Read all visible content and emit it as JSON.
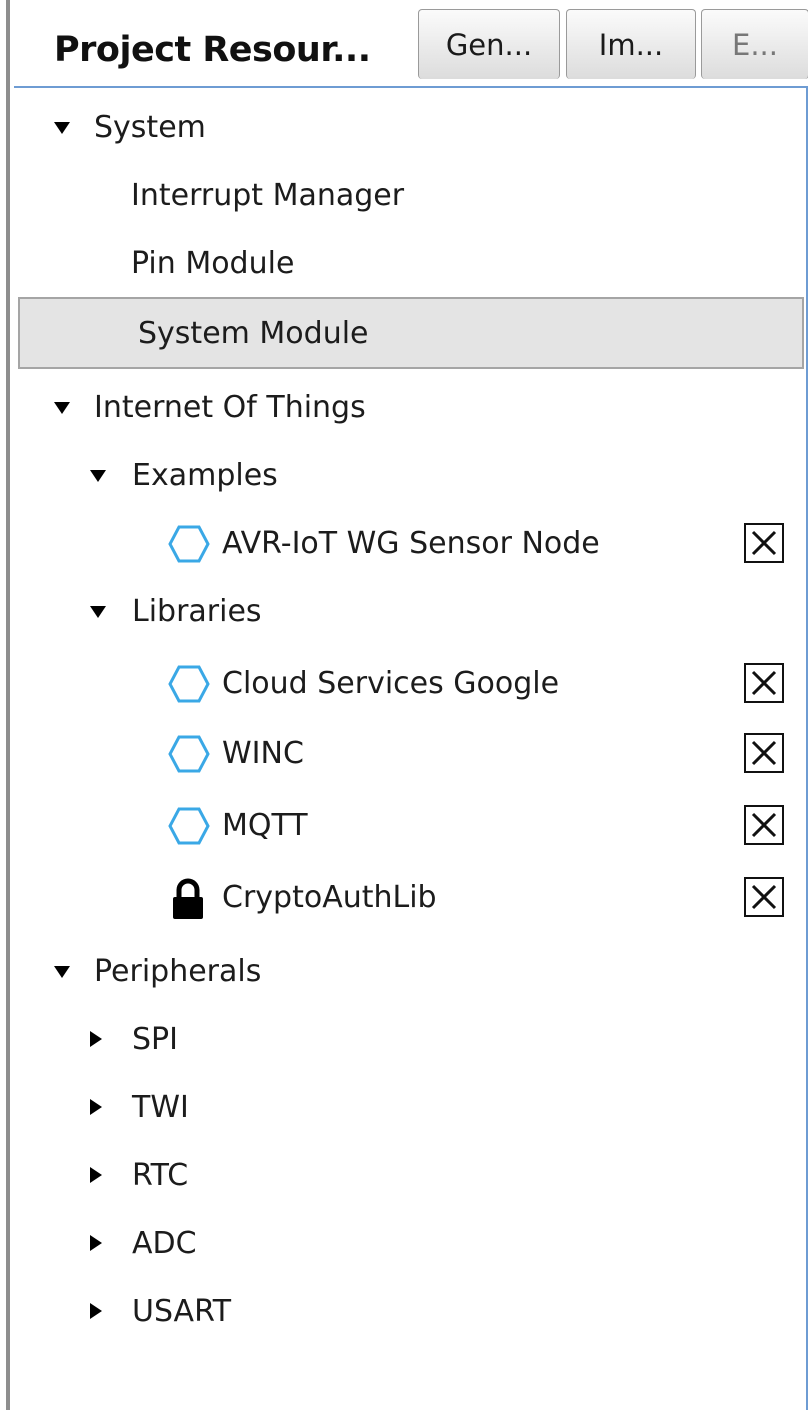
{
  "header": {
    "title": "Project Resour...",
    "buttons": [
      {
        "label": "Gen..."
      },
      {
        "label": "Im..."
      },
      {
        "label": "E..."
      }
    ]
  },
  "tree": {
    "system": {
      "label": "System",
      "children": [
        "Interrupt Manager",
        "Pin Module",
        "System Module"
      ],
      "selected": "System Module"
    },
    "iot": {
      "label": "Internet Of Things",
      "examples": {
        "label": "Examples",
        "items": [
          {
            "label": "AVR-IoT WG Sensor Node",
            "icon": "hexagon-icon"
          }
        ]
      },
      "libraries": {
        "label": "Libraries",
        "items": [
          {
            "label": "Cloud Services Google",
            "icon": "hexagon-icon"
          },
          {
            "label": "WINC",
            "icon": "hexagon-icon"
          },
          {
            "label": "MQTT",
            "icon": "hexagon-icon"
          },
          {
            "label": "CryptoAuthLib",
            "icon": "lock-icon"
          }
        ]
      }
    },
    "peripherals": {
      "label": "Peripherals",
      "items": [
        "SPI",
        "TWI",
        "RTC",
        "ADC",
        "USART"
      ]
    }
  },
  "colors": {
    "hexagon": "#3aa8e6",
    "selection": "#e4e4e4",
    "border": "#6e9cd3"
  }
}
